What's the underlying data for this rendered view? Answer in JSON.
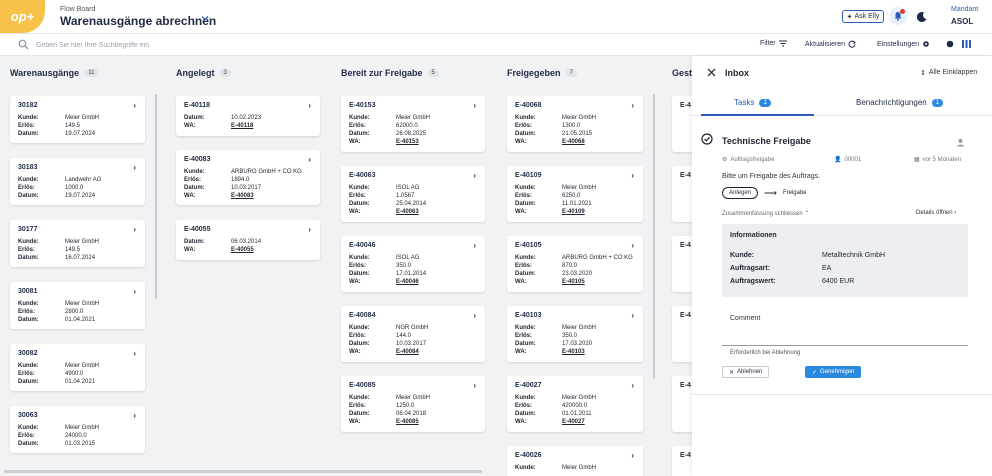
{
  "header": {
    "logo_text": "op+",
    "breadcrumb": "Flow Board",
    "title": "Warenausgänge abrechnen",
    "ask_elly": "Ask Elly",
    "mandant_label": "Mandant",
    "mandant_value": "ASOL"
  },
  "toolbar": {
    "search_placeholder": "Geben Sie hier Ihre Suchbegriffe ein",
    "filter": "Filter",
    "refresh": "Aktualisieren",
    "settings": "Einstellungen"
  },
  "labels": {
    "kunde": "Kunde:",
    "erloes": "Erlös:",
    "datum": "Datum:",
    "wa": "WA:"
  },
  "columns": [
    {
      "title": "Warenausgänge",
      "count": "11",
      "cards": [
        {
          "id": "30182",
          "kunde": "Meier GmbH",
          "erloes": "149.5",
          "datum": "19.07.2024"
        },
        {
          "id": "30183",
          "kunde": "Landwehr AG",
          "erloes": "1000.0",
          "datum": "19.07.2024"
        },
        {
          "id": "30177",
          "kunde": "Meier GmbH",
          "erloes": "149.5",
          "datum": "16.07.2024"
        },
        {
          "id": "30081",
          "kunde": "Meier GmbH",
          "erloes": "2800.0",
          "datum": "01.04.2021"
        },
        {
          "id": "30082",
          "kunde": "Meier GmbH",
          "erloes": "4900.0",
          "datum": "01.04.2021"
        },
        {
          "id": "30063",
          "kunde": "Meier GmbH",
          "erloes": "24000.0",
          "datum": "01.03.2015"
        }
      ]
    },
    {
      "title": "Angelegt",
      "count": "3",
      "cards": [
        {
          "id": "E-40118",
          "datum": "10.02.2023",
          "wa": "E-40118"
        },
        {
          "id": "E-40083",
          "kunde": "ARBURG GmbH + CO KG",
          "erloes": "1894.0",
          "datum": "10.03.2017",
          "wa": "E-40083"
        },
        {
          "id": "E-40055",
          "datum": "06.03.2014",
          "wa": "E-40055"
        }
      ]
    },
    {
      "title": "Bereit zur Freigabe",
      "count": "5",
      "cards": [
        {
          "id": "E-40153",
          "kunde": "Meier GmbH",
          "erloes": "62000.0",
          "datum": "26.08.2025",
          "wa": "E-40153"
        },
        {
          "id": "E-40063",
          "kunde": "ISOL AG",
          "erloes": "1.0567",
          "datum": "25.04.2014",
          "wa": "E-40063"
        },
        {
          "id": "E-40046",
          "kunde": "ISOL AG",
          "erloes": "350.0",
          "datum": "17.01.2014",
          "wa": "E-40046"
        },
        {
          "id": "E-40084",
          "kunde": "NGR GmbH",
          "erloes": "144.0",
          "datum": "10.03.2017",
          "wa": "E-40084"
        },
        {
          "id": "E-40085",
          "kunde": "Meier GmbH",
          "erloes": "1250.0",
          "datum": "06.04.2018",
          "wa": "E-40085"
        }
      ]
    },
    {
      "title": "Freigegeben",
      "count": "7",
      "cards": [
        {
          "id": "E-40068",
          "kunde": "Meier GmbH",
          "erloes": "1300.0",
          "datum": "21.05.2015",
          "wa": "E-40068"
        },
        {
          "id": "E-40109",
          "kunde": "Meier GmbH",
          "erloes": "6250.0",
          "datum": "11.01.2021",
          "wa": "E-40109"
        },
        {
          "id": "E-40105",
          "kunde": "ARBURG GmbH + CO KG",
          "erloes": "870.0",
          "datum": "23.03.2020",
          "wa": "E-40105"
        },
        {
          "id": "E-40103",
          "kunde": "Meier GmbH",
          "erloes": "350.0",
          "datum": "17.03.2020",
          "wa": "E-40103"
        },
        {
          "id": "E-40027",
          "kunde": "Meier GmbH",
          "erloes": "420000.0",
          "datum": "01.01.2011",
          "wa": "E-40027"
        },
        {
          "id": "E-40026",
          "kunde": "Meier GmbH"
        }
      ]
    },
    {
      "title": "Geste",
      "cards": [
        {
          "id": "E-4"
        },
        {
          "id": "E-4"
        },
        {
          "id": "E-4"
        },
        {
          "id": "E-4"
        },
        {
          "id": "E-4"
        },
        {
          "id": "E-4"
        }
      ]
    }
  ],
  "inbox": {
    "title": "Inbox",
    "all_collapse": "Alle Einklappen",
    "tabs": [
      {
        "label": "Tasks",
        "count": "1"
      },
      {
        "label": "Benachrichtigungen",
        "count": "1"
      }
    ],
    "task": {
      "title": "Technische Freigabe",
      "type": "Auftragsfreigabe",
      "user": "00001",
      "time": "vor 5 Monaten",
      "message": "Bitte um Freigabe des Auftrags.",
      "from_state": "Anlegen",
      "to_state": "Freigabe",
      "summary_toggle": "Zusammenfassung schliessen",
      "details": "Details öffnen",
      "info_title": "Informationen",
      "info": [
        {
          "key": "Kunde:",
          "value": "Metalltechnik GmbH"
        },
        {
          "key": "Auftragsart:",
          "value": "EA"
        },
        {
          "key": "Auftragswert:",
          "value": "6400 EUR"
        }
      ],
      "comment_label": "Comment",
      "required_note": "Erforderlich bei Ablehnung",
      "reject": "Ablehnen",
      "approve": "Genehmigen"
    }
  },
  "colors": {
    "accent": "#2b5db8",
    "badge": "#2b8ae0",
    "logo": "#f6c24a",
    "alert": "#e53935"
  }
}
